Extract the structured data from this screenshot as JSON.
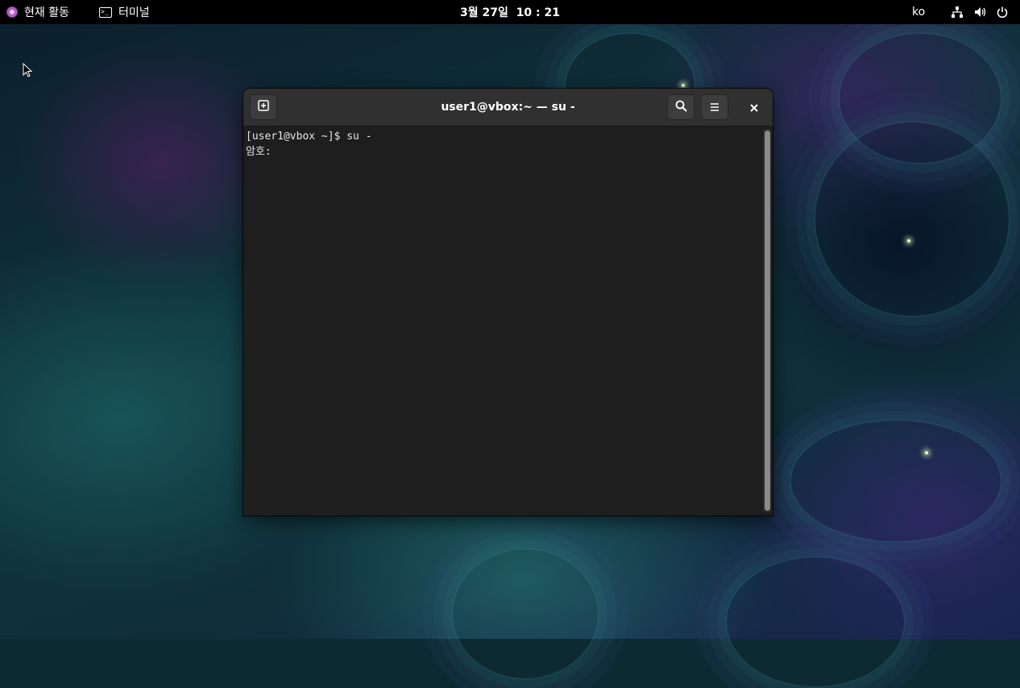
{
  "topbar": {
    "activities_label": "현재 활동",
    "app_menu_label": "터미널",
    "clock": "3월 27일  10 : 21",
    "language": "ko",
    "icons": [
      "network-icon",
      "volume-icon",
      "power-icon"
    ]
  },
  "terminal_window": {
    "title": "user1@vbox:~ — su -",
    "buttons": [
      "new-tab-icon",
      "search-icon",
      "hamburger-menu-icon",
      "close-icon"
    ],
    "lines": [
      "[user1@vbox ~]$ su -",
      "암호:"
    ]
  },
  "colors": {
    "topbar_bg": "#000000",
    "terminal_bg": "#1e1e1e",
    "headerbar_bg": "#303030",
    "text": "#e6e6e6"
  }
}
